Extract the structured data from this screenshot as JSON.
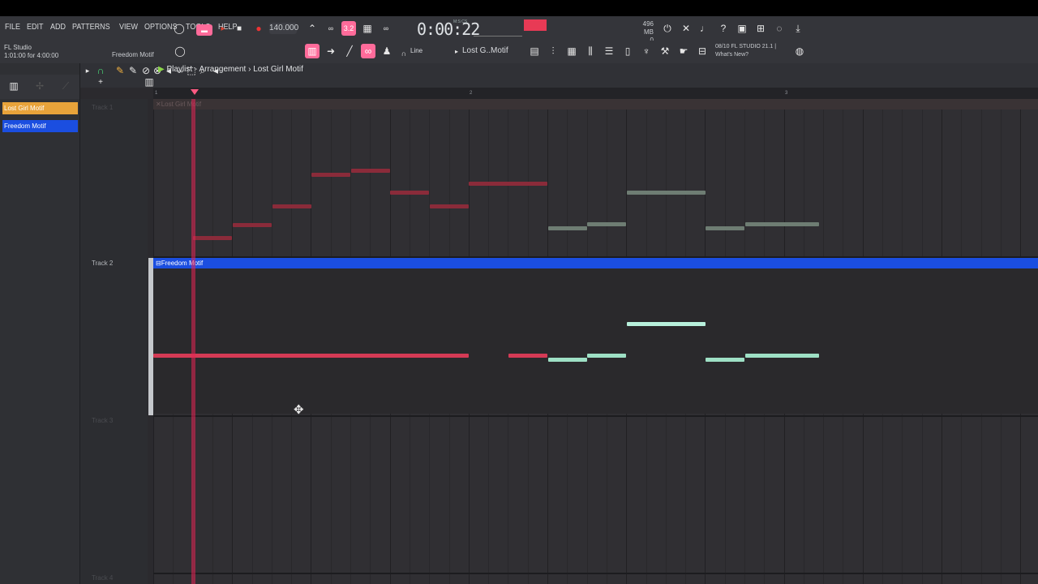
{
  "menu": {
    "items": [
      "FILE",
      "EDIT",
      "ADD",
      "PATTERNS",
      "VIEW",
      "OPTIONS",
      "TOOLS",
      "HELP"
    ]
  },
  "transport": {
    "tempo": "140.000",
    "time": "0:00:22",
    "time_unit": "M:S:CS",
    "cpu_line1": "496 MB",
    "cpu_line2": "0"
  },
  "app": {
    "name": "FL Studio",
    "position": "1:01:00 for 4:00:00",
    "pattern_label": "Freedom Motif"
  },
  "toolbar": {
    "snap": "Line",
    "pattern_selector": "Lost G..Motif"
  },
  "news": {
    "line1": "08/10  FL STUDIO 21.1 |",
    "line2": "What's New?"
  },
  "breadcrumb": {
    "text": "Playlist - Arrangement",
    "sep": "›",
    "pattern": "Lost Girl Motif"
  },
  "patterns": [
    {
      "name": "Lost Girl Motif",
      "color": "#e8a33a"
    },
    {
      "name": "Freedom Motif",
      "color": "#1b4ee0"
    }
  ],
  "ruler": {
    "bars": [
      "1",
      "2",
      "3"
    ]
  },
  "tracks": [
    {
      "label": "Track 1",
      "clip": "Lost Girl Motif"
    },
    {
      "label": "Track 2",
      "clip": "Freedom Motif"
    },
    {
      "label": "Track 3"
    },
    {
      "label": "Track 4"
    }
  ],
  "colors": {
    "accent": "#ff6b9a",
    "red_note": "#c8374c",
    "green_note": "#9ee0c5",
    "clip_blue": "#1b4ee0",
    "clip_orange": "#e8a33a"
  }
}
